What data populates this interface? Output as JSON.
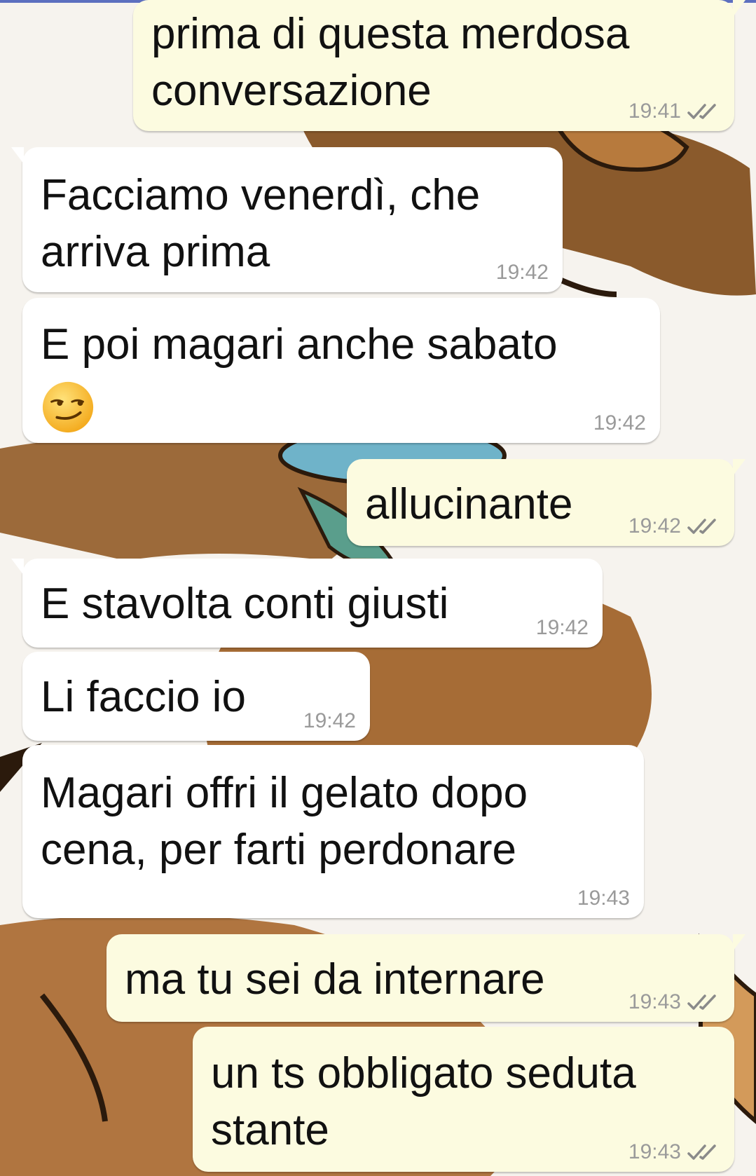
{
  "accent": {
    "outgoing_bubble": "#fcfbe0",
    "incoming_bubble": "#ffffff",
    "read_ticks": "#8a8a8a"
  },
  "messages": [
    {
      "direction": "out",
      "text": "prima di questa merdosa conversazione",
      "time": "19:41",
      "status": "read"
    },
    {
      "direction": "in",
      "text": "Facciamo venerdì, che arriva prima",
      "time": "19:42"
    },
    {
      "direction": "in",
      "text": "E poi magari anche sabato",
      "emoji": "smirking-face",
      "time": "19:42"
    },
    {
      "direction": "out",
      "text": "allucinante",
      "time": "19:42",
      "status": "read"
    },
    {
      "direction": "in",
      "text": "E stavolta conti giusti",
      "time": "19:42"
    },
    {
      "direction": "in",
      "text": "Li faccio io",
      "time": "19:42"
    },
    {
      "direction": "in",
      "text": "Magari offri il gelato dopo cena, per farti perdonare",
      "time": "19:43"
    },
    {
      "direction": "out",
      "text": "ma tu sei da internare",
      "time": "19:43",
      "status": "read"
    },
    {
      "direction": "out",
      "text": "un ts obbligato seduta stante",
      "time": "19:43",
      "status": "read"
    }
  ]
}
